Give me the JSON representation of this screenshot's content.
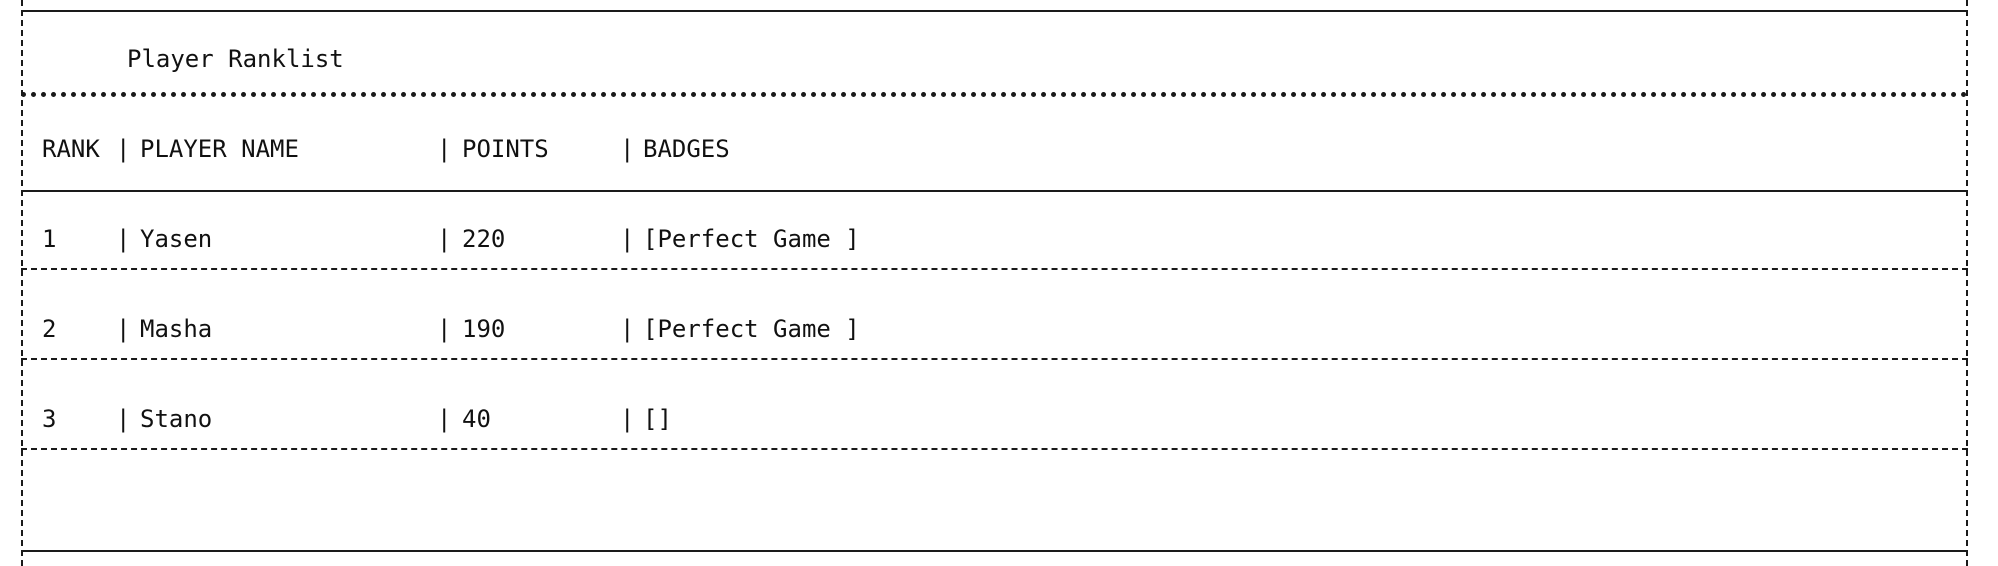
{
  "title": "Player Ranklist",
  "separator_char": "|",
  "table": {
    "headers": {
      "rank": "RANK",
      "player_name": "PLAYER NAME",
      "points": "POINTS",
      "badges": "BADGES"
    },
    "rows": [
      {
        "rank": "1",
        "player_name": "Yasen",
        "points": "220",
        "badges": "[Perfect Game ]"
      },
      {
        "rank": "2",
        "player_name": "Masha",
        "points": "190",
        "badges": "[Perfect Game ]"
      },
      {
        "rank": "3",
        "player_name": "Stano",
        "points": "40",
        "badges": "[]"
      }
    ]
  }
}
